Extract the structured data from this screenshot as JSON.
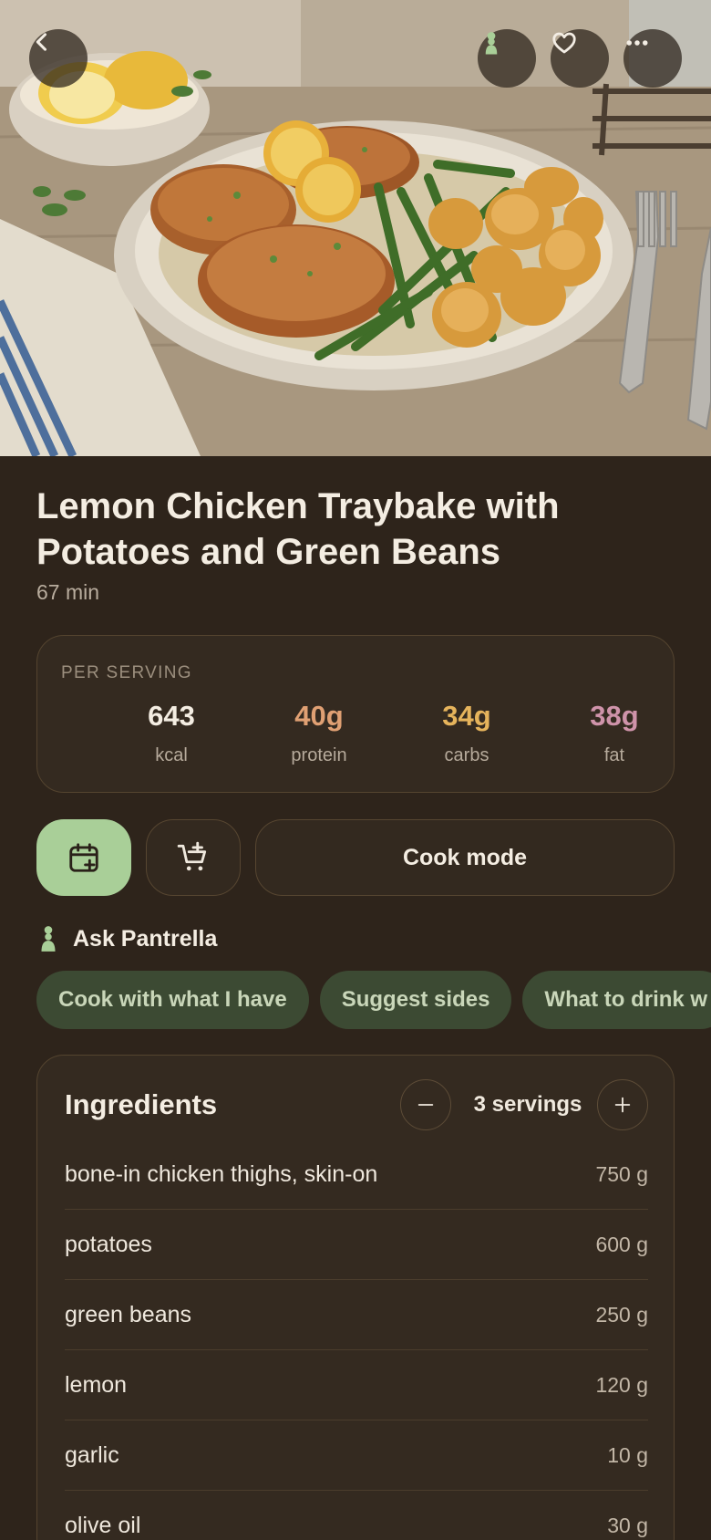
{
  "hero": {
    "icons": [
      "chevron-left-icon",
      "chef-icon",
      "heart-icon",
      "more-icon"
    ]
  },
  "recipe": {
    "title": "Lemon Chicken Traybake with Potatoes and Green Beans",
    "duration": "67 min"
  },
  "nutrition": {
    "label": "PER SERVING",
    "items": [
      {
        "value": "643",
        "unit": "kcal",
        "color": "#f4ede2"
      },
      {
        "value": "40g",
        "unit": "protein",
        "color": "#e0a073"
      },
      {
        "value": "34g",
        "unit": "carbs",
        "color": "#e6b45c"
      },
      {
        "value": "38g",
        "unit": "fat",
        "color": "#cf93aa"
      }
    ]
  },
  "actions": {
    "cook_mode_label": "Cook mode",
    "calendar_icon": "calendar-add-icon",
    "cart_icon": "cart-add-icon",
    "calendar_bg": "#a9cf98"
  },
  "ask": {
    "label": "Ask Pantrella",
    "chips": [
      "Cook with what I have",
      "Suggest sides",
      "What to drink w"
    ]
  },
  "ingredients": {
    "title": "Ingredients",
    "servings": "3 servings",
    "items": [
      {
        "name": "bone-in chicken thighs, skin-on",
        "qty": "750 g"
      },
      {
        "name": "potatoes",
        "qty": "600 g"
      },
      {
        "name": "green beans",
        "qty": "250 g"
      },
      {
        "name": "lemon",
        "qty": "120 g"
      },
      {
        "name": "garlic",
        "qty": "10 g"
      },
      {
        "name": "olive oil",
        "qty": "30 g"
      }
    ]
  }
}
